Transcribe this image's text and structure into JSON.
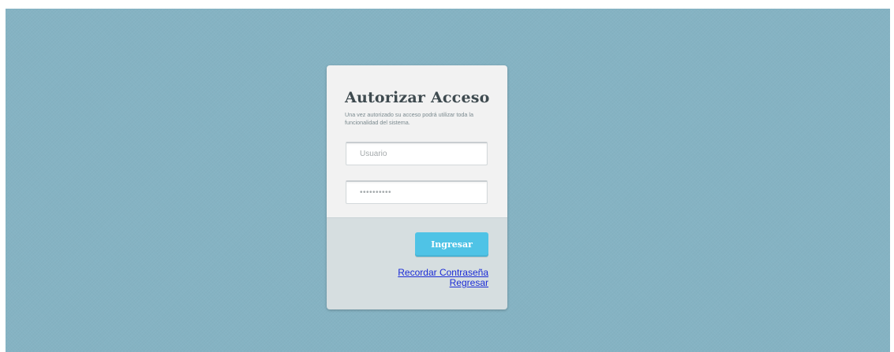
{
  "login": {
    "title": "Autorizar Acceso",
    "subtitle": "Una vez autorizado su acceso podrá utilizar toda la funcionalidad del sistema.",
    "username_placeholder": "Usuario",
    "password_placeholder": "••••••••••",
    "submit_label": "Ingresar",
    "remember_password_link": "Recordar Contraseña",
    "back_link": "Regresar"
  },
  "colors": {
    "background": "#85b3c3",
    "card_top": "#f2f2f2",
    "card_bottom": "#d6dee0",
    "button": "#4fc3e6",
    "link": "#1b2bd6"
  }
}
